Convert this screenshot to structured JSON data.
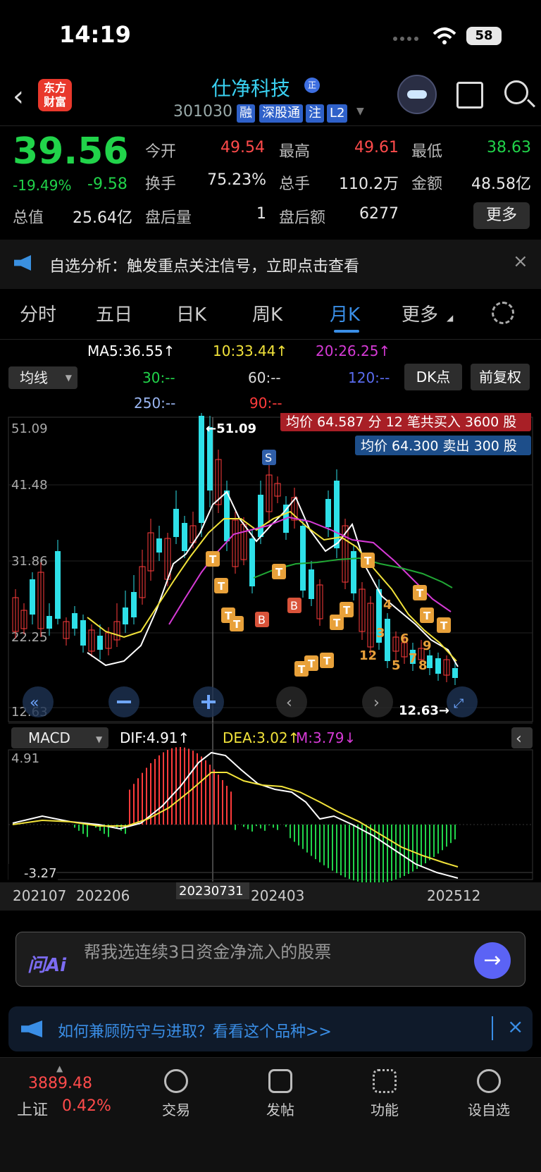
{
  "status": {
    "time": "14:19",
    "battery": "58"
  },
  "header": {
    "name": "仕净科技",
    "name_badge": "正",
    "code": "301030",
    "tags": [
      "融",
      "深股通",
      "注",
      "L2"
    ],
    "logo": "东方\n财富"
  },
  "quote": {
    "price": "39.56",
    "change_pct": "-19.49%",
    "change": "-9.58",
    "fields": [
      {
        "label": "今开",
        "value": "49.54",
        "color": "red"
      },
      {
        "label": "最高",
        "value": "49.61",
        "color": "red"
      },
      {
        "label": "最低",
        "value": "38.63",
        "color": "green"
      },
      {
        "label": "换手",
        "value": "75.23%",
        "color": "white"
      },
      {
        "label": "总手",
        "value": "110.2万",
        "color": "white"
      },
      {
        "label": "金额",
        "value": "48.58亿",
        "color": "white"
      },
      {
        "label": "总值",
        "value": "25.64亿",
        "color": "white"
      },
      {
        "label": "盘后量",
        "value": "1",
        "color": "white"
      },
      {
        "label": "盘后额",
        "value": "6277",
        "color": "white"
      }
    ],
    "more_label": "更多"
  },
  "notice": {
    "text": "自选分析：触发重点关注信号，立即点击查看",
    "close": "×"
  },
  "tabs": [
    {
      "label": "分时"
    },
    {
      "label": "五日"
    },
    {
      "label": "日K"
    },
    {
      "label": "周K"
    },
    {
      "label": "月K",
      "active": true
    },
    {
      "label": "更多"
    }
  ],
  "ma": {
    "ma5": "MA5:36.55↑",
    "ma10": "10:33.44↑",
    "ma20": "20:26.25↑",
    "ma30": "30:--",
    "ma60": "60:--",
    "ma120": "120:--",
    "ma250": "250:--",
    "ma90": "90:--",
    "dropdown_label": "均线",
    "dk_label": "DK点",
    "fq_label": "前复权"
  },
  "chart": {
    "y_ticks": [
      "51.09",
      "41.48",
      "31.86",
      "22.25",
      "12.63"
    ],
    "high_label": "←51.09",
    "low_label": "12.63→",
    "buy_note": "均价 64.587 分 12 笔共买入 3600 股",
    "sell_note": "均价 64.300 卖出 300 股",
    "macd_label": "MACD",
    "dif": "DIF:4.91↑",
    "dea": "DEA:3.02↑",
    "m": "M:3.79↓",
    "macd_top": "4.91",
    "macd_bottom": "-3.27",
    "x_labels": [
      "202107",
      "202206",
      "20230731",
      "202403",
      "202512"
    ]
  },
  "chart_data": {
    "type": "candlestick",
    "x_labels": [
      "202107",
      "202206",
      "20230731",
      "202403",
      "202512"
    ],
    "ylim": [
      12.63,
      51.09
    ],
    "high": 51.09,
    "low": 12.63,
    "macd": {
      "dif": 4.91,
      "dea": 3.02,
      "m": 3.79,
      "ylim": [
        -3.27,
        4.91
      ]
    }
  },
  "ai": {
    "logo": "问Ai",
    "placeholder": "帮我选连续3日资金净流入的股票",
    "send": "→"
  },
  "promo": {
    "text": "如何兼顾防守与进取？看看这个品种>>",
    "close": "×"
  },
  "bottom": {
    "index_value": "3889.48",
    "index_name": "上证",
    "index_pct": "0.42%",
    "items": [
      {
        "label": "交易",
        "icon": "yen-exchange-icon"
      },
      {
        "label": "发帖",
        "icon": "edit-icon"
      },
      {
        "label": "功能",
        "icon": "grid-icon"
      },
      {
        "label": "设自选",
        "icon": "more-icon"
      }
    ]
  }
}
